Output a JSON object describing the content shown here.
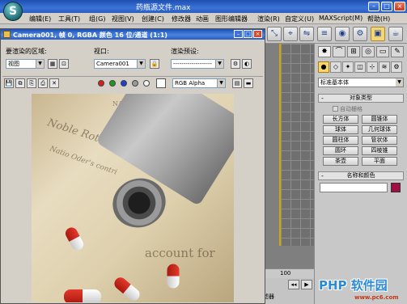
{
  "app": {
    "title": "药瓶源文件.max",
    "logo_letter": "S"
  },
  "menu": [
    "编辑(E)",
    "工具(T)",
    "组(G)",
    "视图(V)",
    "创建(C)",
    "修改器",
    "动画",
    "图形编辑器",
    "渲染(R)",
    "自定义(U)",
    "MAXScript(M)",
    "帮助(H)"
  ],
  "render_window": {
    "title": "Camera001, 帧 0, RGBA 颜色 16 位/通道 (1:1)",
    "area_label": "要渲染的区域:",
    "area_value": "视图",
    "viewport_label": "视口:",
    "viewport_value": "Camera001",
    "preset_label": "渲染预设:",
    "preset_value": "-------------------",
    "channel_value": "RGB Alpha"
  },
  "command_panel": {
    "category": "标准基本体",
    "object_type_title": "对象类型",
    "autogrid": "自动栅格",
    "objects": [
      "长方体",
      "圆锥体",
      "球体",
      "几何球体",
      "圆柱体",
      "管状体",
      "圆环",
      "四棱锥",
      "茶壶",
      "平面"
    ],
    "name_color_title": "名称和颜色",
    "object_color": "#a01045"
  },
  "timeline": {
    "frame_number": "100"
  },
  "bottom": {
    "filter_label": "添加过滤器"
  },
  "render_image": {
    "paper_text_1": "Noble Rotal",
    "paper_text_2": "Natio Oder's contri",
    "paper_text_3": "account for",
    "paper_text_4": "NATIONAL"
  },
  "watermark": {
    "main": "PHP 软件园",
    "url": "www.pc6.com"
  }
}
